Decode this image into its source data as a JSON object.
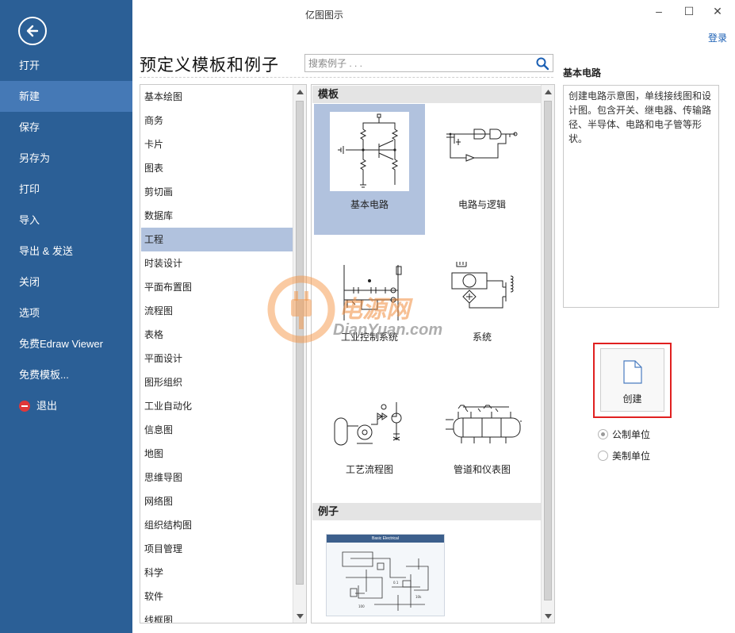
{
  "window": {
    "title": "亿图图示",
    "controls": {
      "minimize": "–",
      "maximize": "☐",
      "close": "✕"
    },
    "login": "登录"
  },
  "sidebar": {
    "back_icon": "back-arrow-icon",
    "items": [
      {
        "label": "打开"
      },
      {
        "label": "新建",
        "active": true
      },
      {
        "label": "保存"
      },
      {
        "label": "另存为"
      },
      {
        "label": "打印"
      },
      {
        "label": "导入"
      },
      {
        "label": "导出 & 发送"
      },
      {
        "label": "关闭"
      },
      {
        "label": "选项"
      },
      {
        "label": "免费Edraw Viewer"
      },
      {
        "label": "免费模板..."
      },
      {
        "label": "退出",
        "icon": "exit-icon"
      }
    ]
  },
  "header": {
    "title": "预定义模板和例子",
    "search_placeholder": "搜索例子 . . ."
  },
  "categories": [
    {
      "label": "基本绘图"
    },
    {
      "label": "商务"
    },
    {
      "label": "卡片"
    },
    {
      "label": "图表"
    },
    {
      "label": "剪切画"
    },
    {
      "label": "数据库"
    },
    {
      "label": "工程",
      "selected": true
    },
    {
      "label": "时装设计"
    },
    {
      "label": "平面布置图"
    },
    {
      "label": "流程图"
    },
    {
      "label": "表格"
    },
    {
      "label": "平面设计"
    },
    {
      "label": "图形组织"
    },
    {
      "label": "工业自动化"
    },
    {
      "label": "信息图"
    },
    {
      "label": "地图"
    },
    {
      "label": "思维导图"
    },
    {
      "label": "网络图"
    },
    {
      "label": "组织结构图"
    },
    {
      "label": "项目管理"
    },
    {
      "label": "科学"
    },
    {
      "label": "软件"
    },
    {
      "label": "线框图"
    }
  ],
  "gallery": {
    "templates_heading": "模板",
    "templates": [
      {
        "label": "基本电路",
        "selected": true
      },
      {
        "label": "电路与逻辑"
      },
      {
        "label": "工业控制系统"
      },
      {
        "label": "系统"
      },
      {
        "label": "工艺流程图"
      },
      {
        "label": "管道和仪表图"
      }
    ],
    "examples_heading": "例子",
    "example_title": "Basic Electrical"
  },
  "details": {
    "title": "基本电路",
    "description": "创建电路示意图，单线接线图和设计图。包含开关、继电器、传输路径、半导体、电路和电子管等形状。",
    "create_label": "创建",
    "units": [
      {
        "label": "公制单位",
        "checked": true
      },
      {
        "label": "美制单位",
        "checked": false
      }
    ]
  },
  "watermark": {
    "name": "电源网",
    "url": "DianYuan.com"
  },
  "colors": {
    "sidebar_bg": "#2b5f96",
    "sidebar_active": "#4579b6",
    "selection": "#b1c2de",
    "highlight_frame": "#e02020",
    "link": "#1a5fb4"
  }
}
